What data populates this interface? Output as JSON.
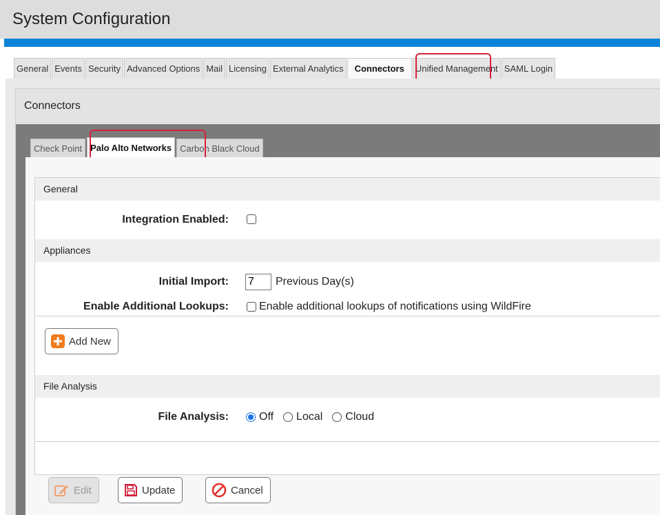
{
  "window": {
    "title": "System Configuration"
  },
  "top_tabs": [
    {
      "label": "General",
      "active": false
    },
    {
      "label": "Events",
      "active": false
    },
    {
      "label": "Security",
      "active": false
    },
    {
      "label": "Advanced Options",
      "active": false
    },
    {
      "label": "Mail",
      "active": false
    },
    {
      "label": "Licensing",
      "active": false
    },
    {
      "label": "External Analytics",
      "active": false
    },
    {
      "label": "Connectors",
      "active": true
    },
    {
      "label": "Unified Management",
      "active": false
    },
    {
      "label": "SAML Login",
      "active": false
    }
  ],
  "panel": {
    "title": "Connectors"
  },
  "sub_tabs": [
    {
      "label": "Check Point",
      "active": false
    },
    {
      "label": "Palo Alto Networks",
      "active": true
    },
    {
      "label": "Carbon Black Cloud",
      "active": false
    }
  ],
  "sections": {
    "general": {
      "heading": "General",
      "integration_enabled": {
        "label": "Integration Enabled:",
        "checked": false
      }
    },
    "appliances": {
      "heading": "Appliances",
      "initial_import": {
        "label": "Initial Import:",
        "value": "7",
        "suffix": "Previous Day(s)"
      },
      "additional_lookups": {
        "label": "Enable Additional Lookups:",
        "checkbox_label": "Enable additional lookups of notifications using WildFire",
        "checked": false
      },
      "add_new_label": "Add New"
    },
    "file_analysis": {
      "heading": "File Analysis",
      "label": "File Analysis:",
      "options": [
        "Off",
        "Local",
        "Cloud"
      ],
      "selected": "Off"
    }
  },
  "footer": {
    "edit_label": "Edit",
    "update_label": "Update",
    "cancel_label": "Cancel"
  },
  "colors": {
    "accent_blue": "#0a84d8",
    "highlight_red": "#d8203c",
    "add_icon_orange": "#f07c1e",
    "cancel_red": "#e0302a",
    "update_red": "#d0203a"
  },
  "icons": {
    "add": "plus-square-icon",
    "edit": "pencil-edit-icon",
    "update": "save-floppy-icon",
    "cancel": "cancel-circle-icon"
  }
}
